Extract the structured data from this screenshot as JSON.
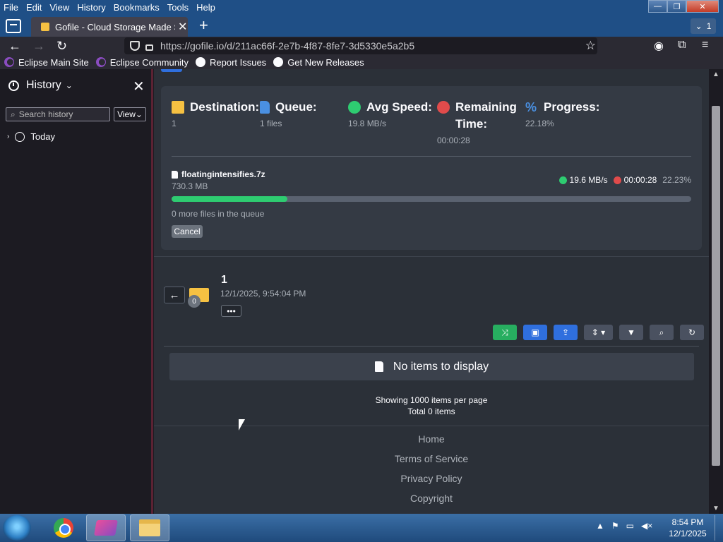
{
  "menu": [
    "File",
    "Edit",
    "View",
    "History",
    "Bookmarks",
    "Tools",
    "Help"
  ],
  "window_controls": {
    "minimize": "—",
    "restore": "❐",
    "close": "✕"
  },
  "tab": {
    "title": "Gofile - Cloud Storage Made Sir",
    "close": "✕",
    "new": "+",
    "list_count": "1"
  },
  "nav": {
    "url": "https://gofile.io/d/211ac66f-2e7b-4f87-8fe7-3d5330e5a2b5"
  },
  "bookmarks": [
    "Eclipse Main Site",
    "Eclipse Community",
    "Report Issues",
    "Get New Releases"
  ],
  "sidebar": {
    "title": "History",
    "search_placeholder": "Search history",
    "view_label": "View",
    "groups": [
      "Today"
    ]
  },
  "upload": {
    "stats": [
      {
        "label": "Destination:",
        "value": "1",
        "icon": "folder-icon"
      },
      {
        "label": "Queue:",
        "value": "1 files",
        "icon": "file-icon"
      },
      {
        "label": "Avg Speed:",
        "value": "19.8 MB/s",
        "icon": "speed-icon"
      },
      {
        "label": "Remaining Time:",
        "value": "00:00:28",
        "icon": "clock-icon"
      },
      {
        "label": "Progress:",
        "value": "22.18%",
        "icon": "percent-icon"
      }
    ],
    "file": {
      "name": "floatingintensifies.7z",
      "size": "730.3 MB",
      "speed": "19.6 MB/s",
      "time": "00:00:28",
      "percent": "22.23%",
      "progress": 0.2223
    },
    "queue_text": "0 more files in the queue",
    "cancel_label": "Cancel"
  },
  "folder": {
    "name": "1",
    "date": "12/1/2025, 9:54:04 PM",
    "badge": "0",
    "more_label": "•••"
  },
  "empty_state": "No items to display",
  "pagination": {
    "per_page": "Showing 1000 items per page",
    "total": "Total 0 items"
  },
  "footer": [
    "Home",
    "Terms of Service",
    "Privacy Policy",
    "Copyright"
  ],
  "taskbar": {
    "time": "8:54 PM",
    "date": "12/1/2025"
  }
}
